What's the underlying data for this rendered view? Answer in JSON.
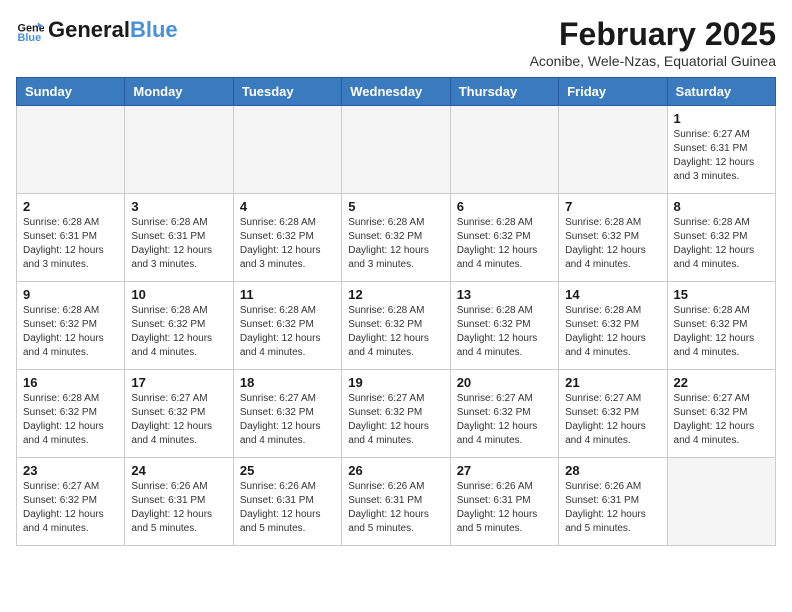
{
  "logo": {
    "line1": "General",
    "line2": "Blue"
  },
  "title": "February 2025",
  "subtitle": "Aconibe, Wele-Nzas, Equatorial Guinea",
  "days_of_week": [
    "Sunday",
    "Monday",
    "Tuesday",
    "Wednesday",
    "Thursday",
    "Friday",
    "Saturday"
  ],
  "weeks": [
    [
      {
        "day": null,
        "info": null
      },
      {
        "day": null,
        "info": null
      },
      {
        "day": null,
        "info": null
      },
      {
        "day": null,
        "info": null
      },
      {
        "day": null,
        "info": null
      },
      {
        "day": null,
        "info": null
      },
      {
        "day": "1",
        "info": "Sunrise: 6:27 AM\nSunset: 6:31 PM\nDaylight: 12 hours\nand 3 minutes."
      }
    ],
    [
      {
        "day": "2",
        "info": "Sunrise: 6:28 AM\nSunset: 6:31 PM\nDaylight: 12 hours\nand 3 minutes."
      },
      {
        "day": "3",
        "info": "Sunrise: 6:28 AM\nSunset: 6:31 PM\nDaylight: 12 hours\nand 3 minutes."
      },
      {
        "day": "4",
        "info": "Sunrise: 6:28 AM\nSunset: 6:32 PM\nDaylight: 12 hours\nand 3 minutes."
      },
      {
        "day": "5",
        "info": "Sunrise: 6:28 AM\nSunset: 6:32 PM\nDaylight: 12 hours\nand 3 minutes."
      },
      {
        "day": "6",
        "info": "Sunrise: 6:28 AM\nSunset: 6:32 PM\nDaylight: 12 hours\nand 4 minutes."
      },
      {
        "day": "7",
        "info": "Sunrise: 6:28 AM\nSunset: 6:32 PM\nDaylight: 12 hours\nand 4 minutes."
      },
      {
        "day": "8",
        "info": "Sunrise: 6:28 AM\nSunset: 6:32 PM\nDaylight: 12 hours\nand 4 minutes."
      }
    ],
    [
      {
        "day": "9",
        "info": "Sunrise: 6:28 AM\nSunset: 6:32 PM\nDaylight: 12 hours\nand 4 minutes."
      },
      {
        "day": "10",
        "info": "Sunrise: 6:28 AM\nSunset: 6:32 PM\nDaylight: 12 hours\nand 4 minutes."
      },
      {
        "day": "11",
        "info": "Sunrise: 6:28 AM\nSunset: 6:32 PM\nDaylight: 12 hours\nand 4 minutes."
      },
      {
        "day": "12",
        "info": "Sunrise: 6:28 AM\nSunset: 6:32 PM\nDaylight: 12 hours\nand 4 minutes."
      },
      {
        "day": "13",
        "info": "Sunrise: 6:28 AM\nSunset: 6:32 PM\nDaylight: 12 hours\nand 4 minutes."
      },
      {
        "day": "14",
        "info": "Sunrise: 6:28 AM\nSunset: 6:32 PM\nDaylight: 12 hours\nand 4 minutes."
      },
      {
        "day": "15",
        "info": "Sunrise: 6:28 AM\nSunset: 6:32 PM\nDaylight: 12 hours\nand 4 minutes."
      }
    ],
    [
      {
        "day": "16",
        "info": "Sunrise: 6:28 AM\nSunset: 6:32 PM\nDaylight: 12 hours\nand 4 minutes."
      },
      {
        "day": "17",
        "info": "Sunrise: 6:27 AM\nSunset: 6:32 PM\nDaylight: 12 hours\nand 4 minutes."
      },
      {
        "day": "18",
        "info": "Sunrise: 6:27 AM\nSunset: 6:32 PM\nDaylight: 12 hours\nand 4 minutes."
      },
      {
        "day": "19",
        "info": "Sunrise: 6:27 AM\nSunset: 6:32 PM\nDaylight: 12 hours\nand 4 minutes."
      },
      {
        "day": "20",
        "info": "Sunrise: 6:27 AM\nSunset: 6:32 PM\nDaylight: 12 hours\nand 4 minutes."
      },
      {
        "day": "21",
        "info": "Sunrise: 6:27 AM\nSunset: 6:32 PM\nDaylight: 12 hours\nand 4 minutes."
      },
      {
        "day": "22",
        "info": "Sunrise: 6:27 AM\nSunset: 6:32 PM\nDaylight: 12 hours\nand 4 minutes."
      }
    ],
    [
      {
        "day": "23",
        "info": "Sunrise: 6:27 AM\nSunset: 6:32 PM\nDaylight: 12 hours\nand 4 minutes."
      },
      {
        "day": "24",
        "info": "Sunrise: 6:26 AM\nSunset: 6:31 PM\nDaylight: 12 hours\nand 5 minutes."
      },
      {
        "day": "25",
        "info": "Sunrise: 6:26 AM\nSunset: 6:31 PM\nDaylight: 12 hours\nand 5 minutes."
      },
      {
        "day": "26",
        "info": "Sunrise: 6:26 AM\nSunset: 6:31 PM\nDaylight: 12 hours\nand 5 minutes."
      },
      {
        "day": "27",
        "info": "Sunrise: 6:26 AM\nSunset: 6:31 PM\nDaylight: 12 hours\nand 5 minutes."
      },
      {
        "day": "28",
        "info": "Sunrise: 6:26 AM\nSunset: 6:31 PM\nDaylight: 12 hours\nand 5 minutes."
      },
      {
        "day": null,
        "info": null
      }
    ]
  ]
}
